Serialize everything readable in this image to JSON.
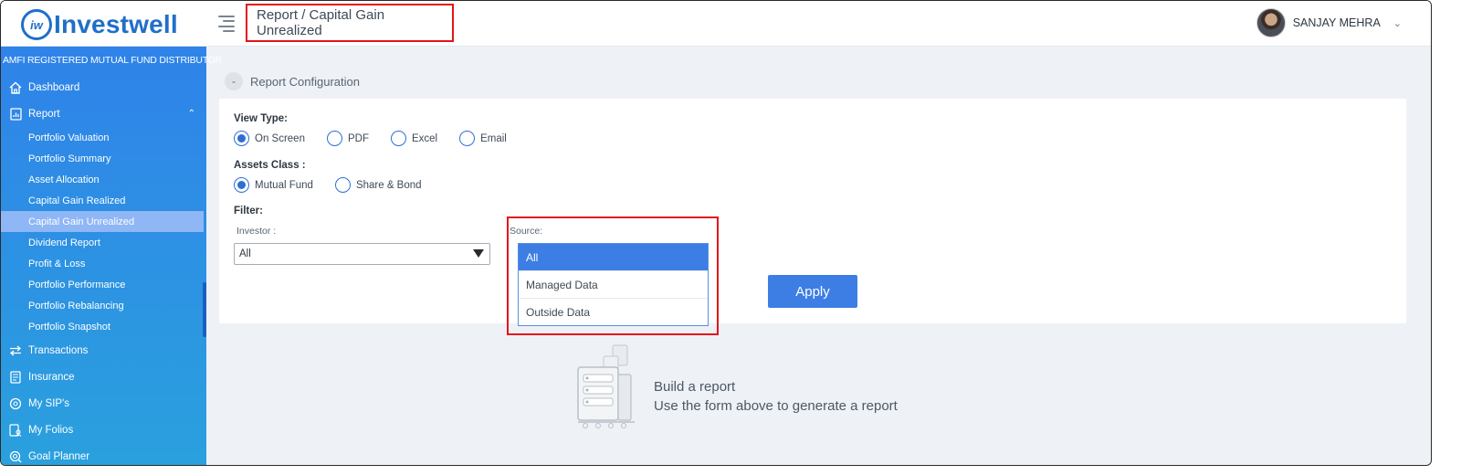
{
  "brand": {
    "badge": "iw",
    "name": "Investwell"
  },
  "header": {
    "breadcrumb": "Report / Capital Gain Unrealized",
    "user_name": "SANJAY MEHRA"
  },
  "sidebar": {
    "tagline": "AMFI REGISTERED MUTUAL FUND DISTRIBUTOR",
    "dashboard": "Dashboard",
    "report": "Report",
    "report_items": [
      "Portfolio Valuation",
      "Portfolio Summary",
      "Asset Allocation",
      "Capital Gain Realized",
      "Capital Gain Unrealized",
      "Dividend Report",
      "Profit & Loss",
      "Portfolio Performance",
      "Portfolio Rebalancing",
      "Portfolio Snapshot"
    ],
    "transactions": "Transactions",
    "insurance": "Insurance",
    "sips": "My SIP's",
    "folios": "My Folios",
    "goal_planner": "Goal Planner"
  },
  "report_config": {
    "toggle": "-",
    "title": "Report Configuration",
    "view_type_label": "View Type:",
    "view_types": [
      "On Screen",
      "PDF",
      "Excel",
      "Email"
    ],
    "view_type_selected": "On Screen",
    "assets_label": "Assets Class :",
    "assets": [
      "Mutual Fund",
      "Share & Bond"
    ],
    "assets_selected": "Mutual Fund",
    "filter_label": "Filter:",
    "investor_label": "Investor :",
    "investor_value": "All",
    "source_label": "Source:",
    "source_options": [
      "All",
      "Managed Data",
      "Outside Data"
    ],
    "source_selected": "All",
    "apply_label": "Apply"
  },
  "empty_state": {
    "title": "Build a report",
    "subtitle": "Use the form above to generate a report"
  },
  "colors": {
    "primary": "#3d7ee4",
    "sidebar_top": "#2f83e9",
    "sidebar_bottom": "#2aa1dd",
    "highlight": "#e3141b"
  }
}
